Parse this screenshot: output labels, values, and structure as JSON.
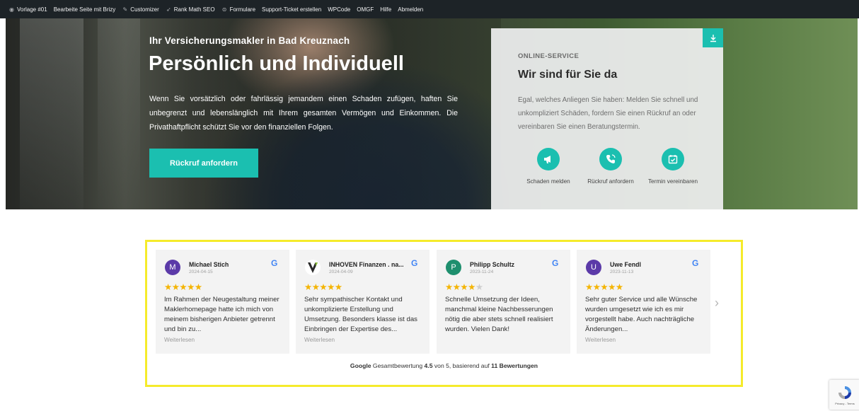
{
  "admin_bar": {
    "items": [
      {
        "label": "Vorlage #01",
        "icon": "dashboard-icon"
      },
      {
        "label": "Bearbeite Seite mit Brizy",
        "icon": ""
      },
      {
        "label": "Customizer",
        "icon": "brush-icon"
      },
      {
        "label": "Rank Math SEO",
        "icon": "rankmath-icon"
      },
      {
        "label": "Formulare",
        "icon": "forms-icon"
      },
      {
        "label": "Support-Ticket erstellen",
        "icon": ""
      },
      {
        "label": "WPCode",
        "icon": ""
      },
      {
        "label": "OMGF",
        "icon": ""
      },
      {
        "label": "Hilfe",
        "icon": ""
      },
      {
        "label": "Abmelden",
        "icon": ""
      }
    ]
  },
  "hero": {
    "subtitle": "Ihr Versicherungsmakler in Bad Kreuznach",
    "title": "Persönlich und Individuell",
    "text": "Wenn Sie vorsätzlich oder fahrlässig jemandem einen Schaden zufügen, haften Sie unbegrenzt und lebenslänglich mit Ihrem gesamten Vermögen und Einkommen. Die Privathaftpflicht schützt Sie vor den finanziellen Folgen.",
    "button_label": "Rückruf anfordern"
  },
  "service": {
    "label": "ONLINE-SERVICE",
    "title": "Wir sind für Sie da",
    "text": "Egal, welches Anliegen Sie haben: Melden Sie schnell und unkompliziert Schäden, fordern Sie einen Rückruf an oder vereinbaren Sie einen Beratungstermin.",
    "actions": [
      {
        "label": "Schaden melden",
        "icon": "megaphone-icon"
      },
      {
        "label": "Rückruf anfordern",
        "icon": "phone-icon"
      },
      {
        "label": "Termin vereinbaren",
        "icon": "calendar-check-icon"
      }
    ]
  },
  "reviews": {
    "items": [
      {
        "initial": "M",
        "avatar_color": "#5b3aa8",
        "name": "Michael Stich",
        "date": "2024-04-15",
        "rating": 5,
        "text": "Im Rahmen der Neugestaltung meiner Maklerhomepage hatte ich mich von meinem bisherigen Anbieter getrennt und bin zu...",
        "more": "Weiterlesen"
      },
      {
        "initial": "V",
        "avatar_color": "#ffffff",
        "name": "INHOVEN Finanzen . na...",
        "date": "2024-04-09",
        "rating": 5,
        "text": "Sehr sympathischer Kontakt und unkomplizierte Erstellung und Umsetzung. Besonders klasse ist das Einbringen der Expertise des...",
        "more": "Weiterlesen"
      },
      {
        "initial": "P",
        "avatar_color": "#1e8f6e",
        "name": "Philipp Schultz",
        "date": "2023-11-24",
        "rating": 4,
        "text": "Schnelle Umsetzung der Ideen, manchmal kleine Nachbesserungen nötig die aber stets schnell realisiert wurden. Vielen Dank!",
        "more": ""
      },
      {
        "initial": "U",
        "avatar_color": "#5b3aa8",
        "name": "Uwe Fendl",
        "date": "2023-11-13",
        "rating": 5,
        "text": "Sehr guter Service und alle Wünsche wurden umgesetzt wie ich es mir vorgestellt habe. Auch nachträgliche Änderungen...",
        "more": "Weiterlesen"
      }
    ],
    "summary": {
      "brand": "Google",
      "label": "Gesamtbewertung",
      "score": "4.5",
      "middle": "von 5, basierend auf",
      "count": "11 Bewertungen"
    }
  },
  "recaptcha": {
    "text": "Privacy - Terms"
  },
  "colors": {
    "accent": "#1bbfb0",
    "highlight_frame": "#f5eb2b",
    "star": "#f4b400"
  }
}
